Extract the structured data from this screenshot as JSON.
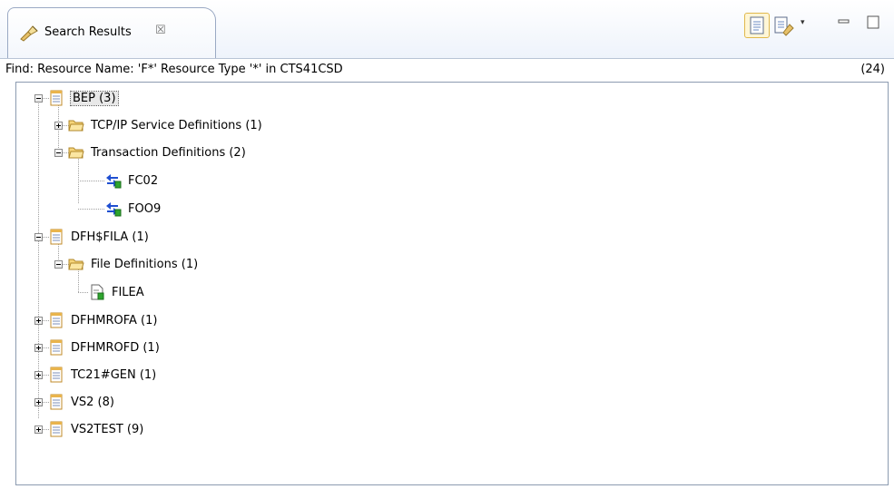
{
  "tab": {
    "title": "Search Results",
    "close_glyph": "☒"
  },
  "toolbar": {
    "history_dropdown_glyph": "▾"
  },
  "summary": {
    "text": "Find: Resource Name: 'F*' Resource Type '*' in CTS41CSD",
    "count": "(24)"
  },
  "tree": [
    {
      "label": "BEP (3)",
      "icon": "group-doc-icon",
      "expanded": true,
      "selected": true
    },
    {
      "label": "TCP/IP Service Definitions (1)",
      "icon": "folder-icon",
      "expanded": false
    },
    {
      "label": "Transaction Definitions (2)",
      "icon": "folder-icon",
      "expanded": true
    },
    {
      "label": "FC02",
      "icon": "transaction-icon"
    },
    {
      "label": "FOO9",
      "icon": "transaction-icon"
    },
    {
      "label": "DFH$FILA (1)",
      "icon": "group-doc-icon",
      "expanded": true
    },
    {
      "label": "File Definitions (1)",
      "icon": "folder-icon",
      "expanded": true
    },
    {
      "label": "FILEA",
      "icon": "file-definition-icon"
    },
    {
      "label": "DFHMROFA (1)",
      "icon": "group-doc-icon",
      "expanded": false
    },
    {
      "label": "DFHMROFD (1)",
      "icon": "group-doc-icon",
      "expanded": false
    },
    {
      "label": "TC21#GEN (1)",
      "icon": "group-doc-icon",
      "expanded": false
    },
    {
      "label": "VS2 (8)",
      "icon": "group-doc-icon",
      "expanded": false
    },
    {
      "label": "VS2TEST (9)",
      "icon": "group-doc-icon",
      "expanded": false
    }
  ]
}
